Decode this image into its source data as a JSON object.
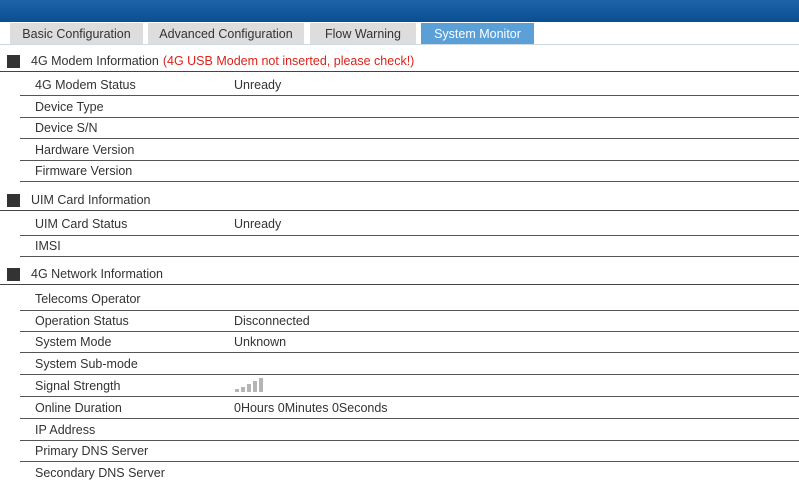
{
  "tabs": [
    {
      "label": "Basic Configuration"
    },
    {
      "label": "Advanced Configuration"
    },
    {
      "label": "Flow Warning"
    },
    {
      "label": "System Monitor",
      "active": true
    }
  ],
  "modem": {
    "title": "4G Modem Information",
    "warning": "(4G USB Modem not inserted, please check!)",
    "rows": [
      {
        "label": "4G Modem Status",
        "value": "Unready"
      },
      {
        "label": "Device Type",
        "value": ""
      },
      {
        "label": "Device S/N",
        "value": ""
      },
      {
        "label": "Hardware Version",
        "value": ""
      },
      {
        "label": "Firmware Version",
        "value": ""
      }
    ]
  },
  "uim": {
    "title": "UIM Card Information",
    "rows": [
      {
        "label": "UIM Card Status",
        "value": "Unready"
      },
      {
        "label": "IMSI",
        "value": ""
      }
    ]
  },
  "network": {
    "title": "4G Network Information",
    "rows": [
      {
        "label": "Telecoms Operator",
        "value": ""
      },
      {
        "label": "Operation Status",
        "value": "Disconnected"
      },
      {
        "label": "System Mode",
        "value": "Unknown"
      },
      {
        "label": "System Sub-mode",
        "value": ""
      },
      {
        "label": "Signal Strength",
        "value": ""
      },
      {
        "label": "Online Duration",
        "value": "0Hours 0Minutes 0Seconds"
      },
      {
        "label": "IP Address",
        "value": ""
      },
      {
        "label": "Primary DNS Server",
        "value": ""
      },
      {
        "label": "Secondary DNS Server",
        "value": ""
      }
    ],
    "signal_icon": "signal-strength-icon",
    "signal_bars_total": 5,
    "signal_bars_active": 0
  },
  "colors": {
    "header_blue": "#0b4f93",
    "active_tab": "#5a9fd6",
    "inactive_tab": "#dddddd",
    "warning_red": "#d9231b"
  }
}
